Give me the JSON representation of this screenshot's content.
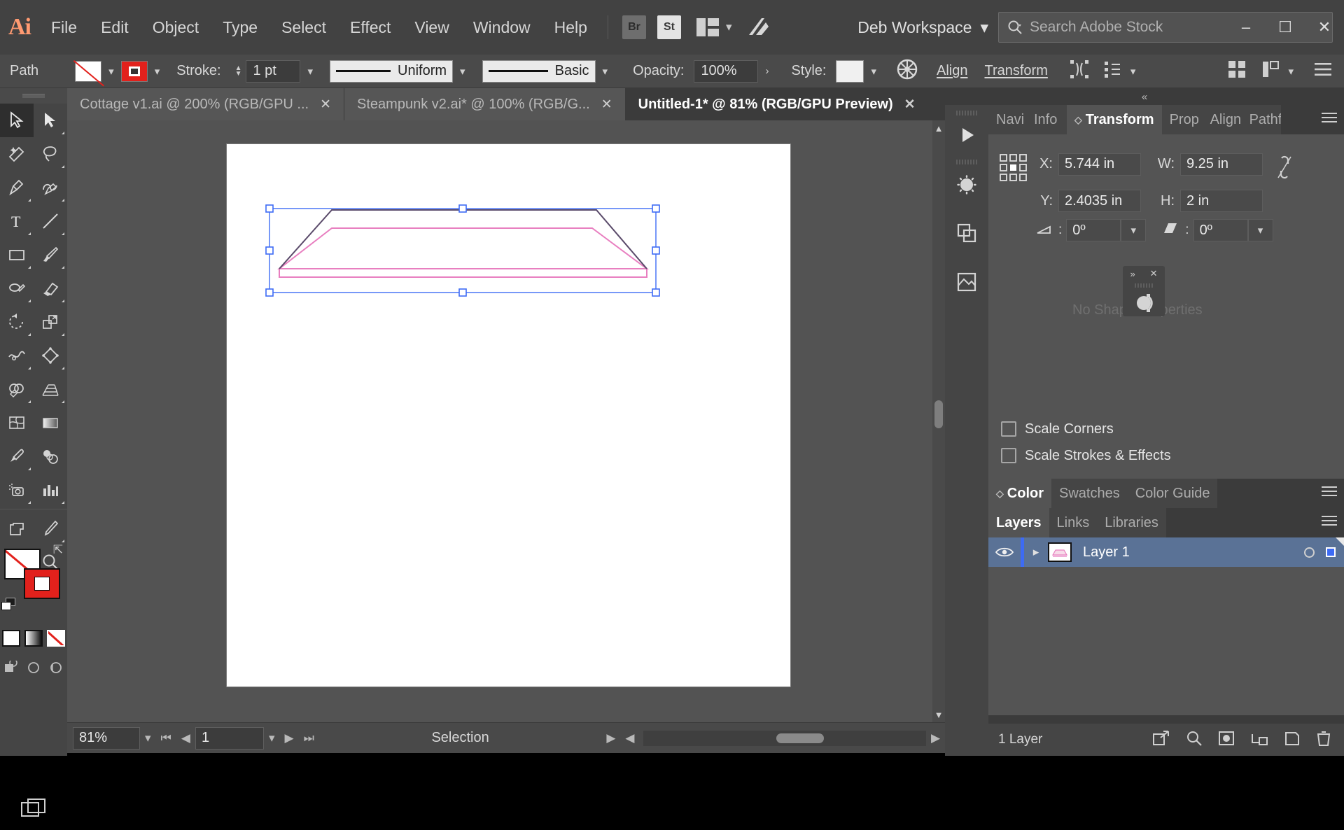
{
  "app": {
    "name": "Ai",
    "logo_color": "#ff9a71"
  },
  "menubar": {
    "items": [
      "File",
      "Edit",
      "Object",
      "Type",
      "Select",
      "Effect",
      "View",
      "Window",
      "Help"
    ],
    "bridge_label": "Br",
    "stock_label": "St",
    "workspace_label": "Deb Workspace",
    "search_placeholder": "Search Adobe Stock"
  },
  "window_controls": {
    "minimize": "–",
    "maximize": "☐",
    "close": "✕"
  },
  "controlbar": {
    "object_label": "Path",
    "stroke_label": "Stroke:",
    "stroke_weight": "1 pt",
    "profile_label": "Uniform",
    "brush_label": "Basic",
    "opacity_label": "Opacity:",
    "opacity_value": "100%",
    "opacity_more": "›",
    "style_label": "Style:",
    "align_label": "Align",
    "transform_label": "Transform"
  },
  "tabs": [
    {
      "title": "Cottage v1.ai @ 200% (RGB/GPU ...",
      "active": false,
      "close": "✕"
    },
    {
      "title": "Steampunk v2.ai* @ 100% (RGB/G...",
      "active": false,
      "close": "✕"
    },
    {
      "title": "Untitled-1* @ 81% (RGB/GPU Preview)",
      "active": true,
      "close": "✕"
    }
  ],
  "statusbar": {
    "zoom": "81%",
    "page": "1",
    "tool_status": "Selection"
  },
  "right_dock": {
    "collapse_glyph": "«",
    "panel_tabs": [
      {
        "label": "Navi",
        "active": false
      },
      {
        "label": "Info",
        "active": false
      },
      {
        "label": "Transform",
        "active": true
      },
      {
        "label": "Prop",
        "active": false
      },
      {
        "label": "Align",
        "active": false
      },
      {
        "label": "Pathf",
        "active": false
      }
    ],
    "transform": {
      "x_label": "X:",
      "x_value": "5.744 in",
      "y_label": "Y:",
      "y_value": "2.4035 in",
      "w_label": "W:",
      "w_value": "9.25 in",
      "h_label": "H:",
      "h_value": "2 in",
      "angle_value": "0º",
      "shear_value": "0º",
      "scale_corners_label": "Scale Corners",
      "scale_strokes_label": "Scale Strokes & Effects",
      "scale_corners_checked": false,
      "scale_strokes_checked": false
    },
    "shape_panel": {
      "empty_text": "No Shape Properties",
      "popup_collapse": "»",
      "popup_close": "✕"
    },
    "color_tabs": [
      {
        "label": "Color",
        "active": true
      },
      {
        "label": "Swatches",
        "active": false
      },
      {
        "label": "Color Guide",
        "active": false
      }
    ],
    "layers_tabs": [
      {
        "label": "Layers",
        "active": true
      },
      {
        "label": "Links",
        "active": false
      },
      {
        "label": "Libraries",
        "active": false
      }
    ],
    "layers": [
      {
        "name": "Layer 1",
        "visible": true,
        "selected": true,
        "color": "#3d6bf5"
      }
    ],
    "layers_footer": {
      "count_label": "1 Layer"
    }
  },
  "toolbar": {
    "tools": [
      {
        "name": "selection-tool",
        "selected": true
      },
      {
        "name": "direct-selection-tool",
        "selected": false
      },
      {
        "name": "magic-wand-tool",
        "selected": false
      },
      {
        "name": "lasso-tool",
        "selected": false
      },
      {
        "name": "pen-tool",
        "selected": false
      },
      {
        "name": "curvature-tool",
        "selected": false
      },
      {
        "name": "type-tool",
        "selected": false
      },
      {
        "name": "line-segment-tool",
        "selected": false
      },
      {
        "name": "rectangle-tool",
        "selected": false
      },
      {
        "name": "paintbrush-tool",
        "selected": false
      },
      {
        "name": "shaper-tool",
        "selected": false
      },
      {
        "name": "eraser-tool",
        "selected": false
      },
      {
        "name": "rotate-tool",
        "selected": false
      },
      {
        "name": "scale-tool",
        "selected": false
      },
      {
        "name": "width-tool",
        "selected": false
      },
      {
        "name": "free-transform-tool",
        "selected": false
      },
      {
        "name": "shape-builder-tool",
        "selected": false
      },
      {
        "name": "perspective-grid-tool",
        "selected": false
      },
      {
        "name": "mesh-tool",
        "selected": false
      },
      {
        "name": "gradient-tool",
        "selected": false
      },
      {
        "name": "eyedropper-tool",
        "selected": false
      },
      {
        "name": "blend-tool",
        "selected": false
      },
      {
        "name": "symbol-sprayer-tool",
        "selected": false
      },
      {
        "name": "column-graph-tool",
        "selected": false
      },
      {
        "name": "artboard-tool",
        "selected": false
      },
      {
        "name": "slice-tool",
        "selected": false
      },
      {
        "name": "hand-tool",
        "selected": false
      },
      {
        "name": "zoom-tool",
        "selected": false
      }
    ],
    "fill_color": "#ffffff",
    "fill_is_none": true,
    "stroke_color": "#e2211c"
  },
  "canvas": {
    "artboard_background": "#ffffff",
    "selection_color": "#3d6bf5",
    "path_color": "#e87fc0"
  }
}
